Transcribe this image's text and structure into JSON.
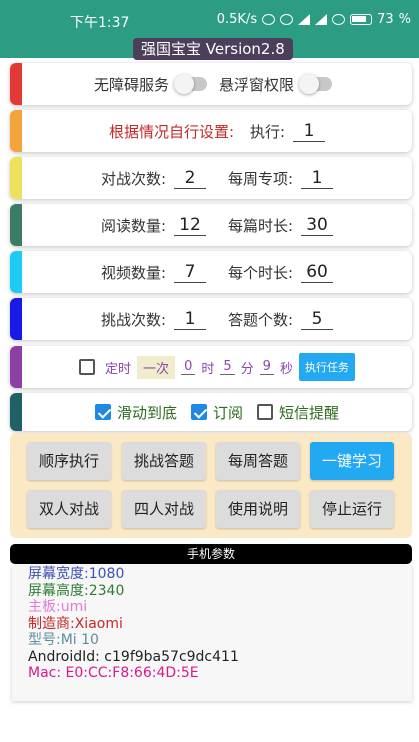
{
  "status": {
    "time": "下午1:37",
    "speed": "0.5K/s",
    "battery": "73"
  },
  "app": {
    "title": "强国宝宝 Version2.8"
  },
  "permissions": {
    "accessibility_label": "无障碍服务",
    "accessibility_on": false,
    "overlay_label": "悬浮窗权限",
    "overlay_on": false
  },
  "settings": {
    "hint": "根据情况自行设置:",
    "execute_label": "执行:",
    "execute_value": "1",
    "battle_label": "对战次数:",
    "battle_value": "2",
    "weekly_label": "每周专项:",
    "weekly_value": "1",
    "read_count_label": "阅读数量:",
    "read_count_value": "12",
    "read_time_label": "每篇时长:",
    "read_time_value": "30",
    "video_count_label": "视频数量:",
    "video_count_value": "7",
    "video_time_label": "每个时长:",
    "video_time_value": "60",
    "challenge_label": "挑战次数:",
    "challenge_value": "1",
    "answer_label": "答题个数:",
    "answer_value": "5"
  },
  "timer": {
    "label": "定时",
    "mode": "一次",
    "hour": "0",
    "hour_unit": "时",
    "minute": "5",
    "minute_unit": "分",
    "second": "9",
    "second_unit": "秒",
    "run_button": "执行任务",
    "checked": false
  },
  "options": {
    "scroll_label": "滑动到底",
    "scroll_checked": true,
    "subscribe_label": "订阅",
    "subscribe_checked": true,
    "sms_label": "短信提醒",
    "sms_checked": false
  },
  "buttons": [
    "顺序执行",
    "挑战答题",
    "每周答题",
    "一键学习",
    "双人对战",
    "四人对战",
    "使用说明",
    "停止运行"
  ],
  "device": {
    "header": "手机参数",
    "lines": [
      {
        "text": "屏幕宽度:1080",
        "color": "#3f51b5"
      },
      {
        "text": "屏幕高度:2340",
        "color": "#2e7d32"
      },
      {
        "text": "主板:umi",
        "color": "#e57bd0"
      },
      {
        "text": "制造商:Xiaomi",
        "color": "#c62828"
      },
      {
        "text": "型号:Mi 10",
        "color": "#5c8f9e"
      },
      {
        "text": "AndroidId: c19f9ba57c9dc411",
        "color": "#222222"
      },
      {
        "text": "Mac: E0:CC:F8:66:4D:5E",
        "color": "#d81b8a"
      }
    ]
  },
  "accent_colors": {
    "header": "#2c9c83",
    "button": "#23a8f2",
    "panel": "#fbe9c6"
  }
}
